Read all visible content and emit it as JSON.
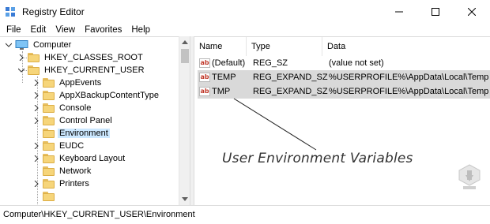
{
  "window": {
    "title": "Registry Editor"
  },
  "menu": [
    "File",
    "Edit",
    "View",
    "Favorites",
    "Help"
  ],
  "tree": {
    "root": "Computer",
    "items": [
      {
        "label": "HKEY_CLASSES_ROOT"
      },
      {
        "label": "HKEY_CURRENT_USER"
      },
      {
        "label": "AppEvents"
      },
      {
        "label": "AppXBackupContentType"
      },
      {
        "label": "Console"
      },
      {
        "label": "Control Panel"
      },
      {
        "label": "Environment",
        "selected": true
      },
      {
        "label": "EUDC"
      },
      {
        "label": "Keyboard Layout"
      },
      {
        "label": "Network"
      },
      {
        "label": "Printers"
      }
    ]
  },
  "list": {
    "columns": [
      "Name",
      "Type",
      "Data"
    ],
    "rows": [
      {
        "name": "(Default)",
        "type": "REG_SZ",
        "data": "(value not set)",
        "icon": "ab-string-icon"
      },
      {
        "name": "TEMP",
        "type": "REG_EXPAND_SZ",
        "data": "%USERPROFILE%\\AppData\\Local\\Temp",
        "icon": "ab-string-icon"
      },
      {
        "name": "TMP",
        "type": "REG_EXPAND_SZ",
        "data": "%USERPROFILE%\\AppData\\Local\\Temp",
        "icon": "ab-string-icon"
      }
    ]
  },
  "annotation": "User Environment Variables",
  "status": {
    "path": "Computer\\HKEY_CURRENT_USER\\Environment"
  },
  "colors": {
    "selection": "#cce8ff",
    "highlight_rows": "#d9d9d9",
    "folder": "#f6d57a"
  }
}
